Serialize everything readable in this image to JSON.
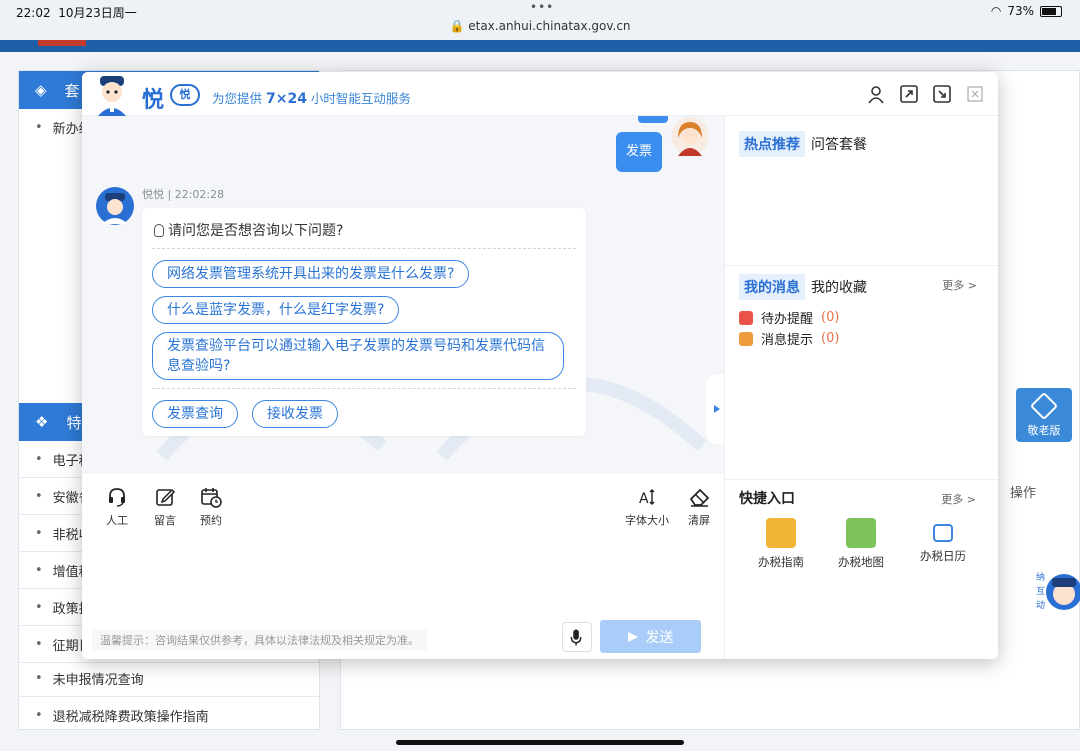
{
  "status": {
    "time": "22:02",
    "date": "10月23日周一",
    "url": "etax.anhui.chinatax.gov.cn",
    "battery": "73%"
  },
  "background": {
    "panel1_title": "套",
    "panel1_rows": [
      "新办纳"
    ],
    "panel2_title": "特",
    "panel2_rows": [
      "电子税",
      "安徽省",
      "非税收",
      "增值税",
      "政策指",
      "征期日",
      "未申报情况查询",
      "退税减税降费政策操作指南"
    ],
    "operation": "操作",
    "old_version": "敬老版"
  },
  "chatbot": {
    "logo": "悦",
    "logo_badge": "悦",
    "slogan_pre": "为您提供 ",
    "slogan_hl": "7×24",
    "slogan_post": " 小时智能互动服务",
    "user_message": "发票",
    "bot_name_time": "悦悦 | 22:02:28",
    "bot_question": "请问您是否想咨询以下问题?",
    "suggestions": [
      "网络发票管理系统开具出来的发票是什么发票?",
      "什么是蓝字发票，什么是红字发票?",
      "发票查验平台可以通过输入电子发票的发票号码和发票代码信息查验吗?"
    ],
    "quick_tags": [
      "发票查询",
      "接收发票"
    ],
    "tools": {
      "human": "人工",
      "message": "留言",
      "appointment": "预约",
      "font_size": "字体大小",
      "clear": "清屏"
    },
    "tip": "温馨提示：咨询结果仅供参考，具体以法律法规及相关规定为准。",
    "send": "发送"
  },
  "sidebar": {
    "hot_tab": "热点推荐",
    "qa_tab": "问答套餐",
    "msg_tab": "我的消息",
    "fav_tab": "我的收藏",
    "more": "更多 >",
    "todo_label": "待办提醒",
    "todo_count": "(0)",
    "notice_label": "消息提示",
    "notice_count": "(0)",
    "quick_title": "快捷入口",
    "quick_more": "更多 >",
    "quick_items": [
      "办税指南",
      "办税地图",
      "办税日历"
    ]
  }
}
